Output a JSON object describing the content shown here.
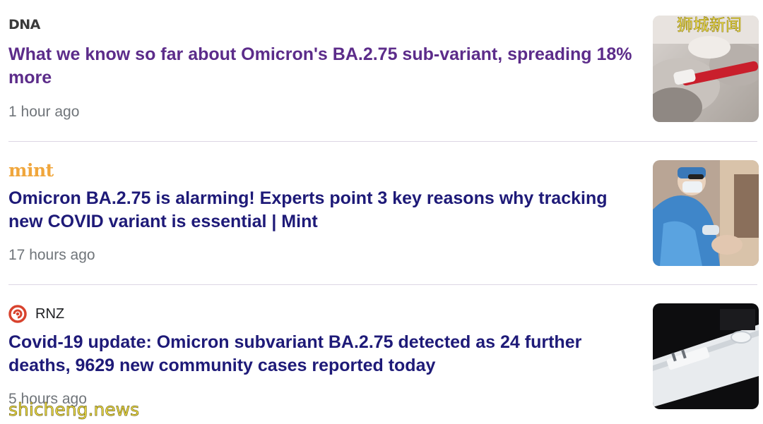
{
  "articles": [
    {
      "source": "DNA",
      "headline": "What we know so far about Omicron's BA.2.75 sub-variant, spreading 18% more",
      "time": "1 hour ago",
      "visited": true
    },
    {
      "source": "mint",
      "headline": "Omicron BA.2.75 is alarming! Experts point 3 key reasons why tracking new COVID variant is essential | Mint",
      "time": "17 hours ago",
      "visited": false
    },
    {
      "source": "RNZ",
      "source_icon": "rnz-logo-icon",
      "headline": "Covid-19 update: Omicron subvariant BA.2.75 detected as 24 further deaths, 9629 new community cases reported today",
      "time": "5 hours ago",
      "visited": false
    }
  ],
  "watermarks": {
    "top_right": "狮城新闻",
    "bottom_left": "shicheng.news"
  },
  "colors": {
    "headline_visited": "#5c2c8a",
    "headline_link": "#1e1a78",
    "timestamp": "#70757a",
    "divider": "#dcd6e4",
    "mint_brand": "#f0a63c",
    "rnz_brand": "#d8432e",
    "watermark": "#f4e24a"
  }
}
